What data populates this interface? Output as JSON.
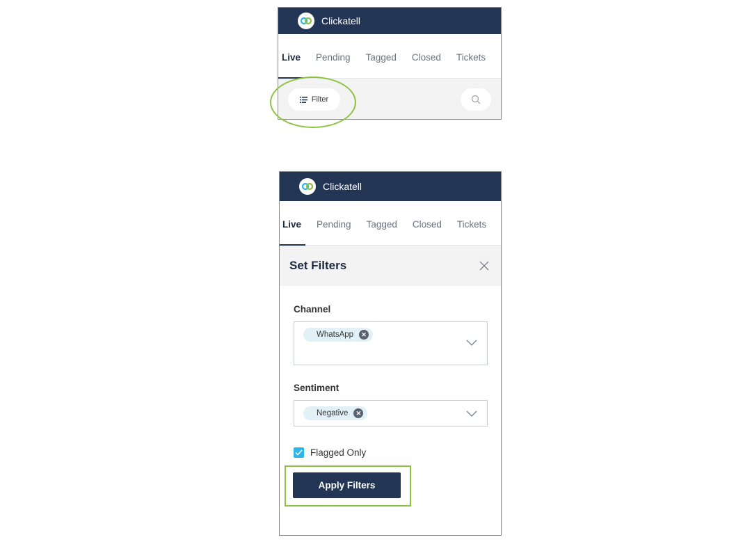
{
  "top_panel": {
    "brand": "Clickatell",
    "tabs": [
      "Live",
      "Pending",
      "Tagged",
      "Closed",
      "Tickets"
    ],
    "filter_label": "Filter"
  },
  "bottom_panel": {
    "brand": "Clickatell",
    "tabs": [
      "Live",
      "Pending",
      "Tagged",
      "Closed",
      "Tickets"
    ],
    "set_filters_title": "Set Filters",
    "channel": {
      "label": "Channel",
      "selected": "WhatsApp"
    },
    "sentiment": {
      "label": "Sentiment",
      "selected": "Negative"
    },
    "flagged_only": {
      "label": "Flagged Only",
      "checked": true
    },
    "apply_label": "Apply Filters"
  },
  "colors": {
    "header": "#233555",
    "highlight": "#8cc240",
    "checkbox": "#2db6e8",
    "chip": "#e2f0f8"
  },
  "icons": [
    "clickatell-logo-icon",
    "filter-list-icon",
    "search-icon",
    "close-icon",
    "chip-remove-icon",
    "chevron-down-icon",
    "check-icon"
  ]
}
